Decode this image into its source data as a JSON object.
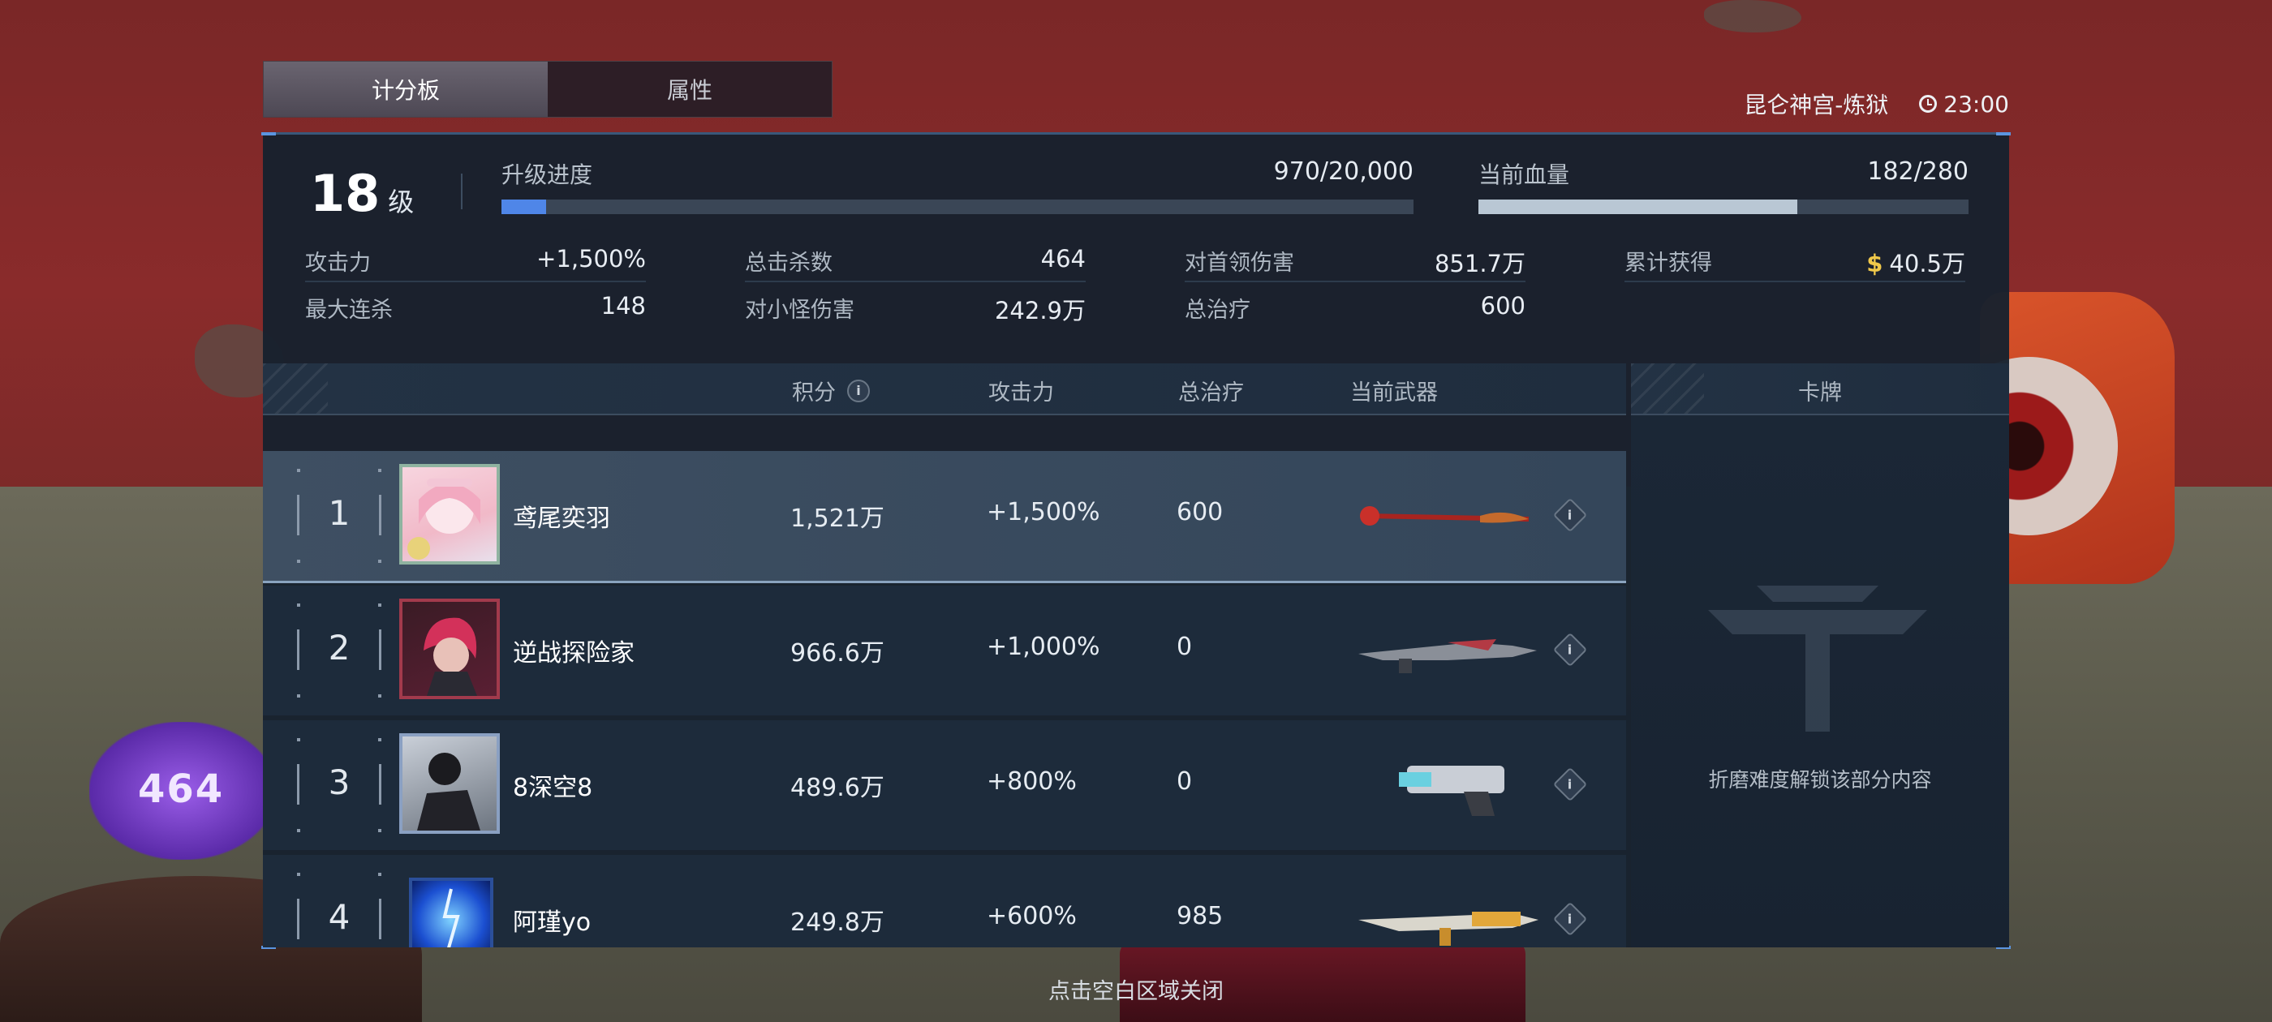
{
  "tabs": [
    {
      "label": "计分板",
      "active": true
    },
    {
      "label": "属性",
      "active": false
    }
  ],
  "map_name": "昆仑神宫-炼狱",
  "timer": "23:00",
  "level": {
    "value": "18",
    "unit": "级"
  },
  "upgrade_progress": {
    "label": "升级进度",
    "value": "970/20,000",
    "fraction": 0.0485,
    "color": "#4f86e8"
  },
  "hp": {
    "label": "当前血量",
    "value": "182/280",
    "fraction": 0.65,
    "color": "#b9c7d4"
  },
  "stats": {
    "attack": {
      "label": "攻击力",
      "value": "+1,500%"
    },
    "max_combo": {
      "label": "最大连杀",
      "value": "148"
    },
    "total_kills": {
      "label": "总击杀数",
      "value": "464"
    },
    "minion_damage": {
      "label": "对小怪伤害",
      "value": "242.9万"
    },
    "boss_damage": {
      "label": "对首领伤害",
      "value": "851.7万"
    },
    "total_heal": {
      "label": "总治疗",
      "value": "600"
    },
    "earned": {
      "label": "累计获得",
      "value": "40.5万",
      "currency_icon": "$"
    }
  },
  "table": {
    "headers": {
      "score": "积分",
      "attack": "攻击力",
      "heal": "总治疗",
      "weapon": "当前武器"
    },
    "info_icon": "i",
    "rows": [
      {
        "rank": "1",
        "name": "鸢尾奕羽",
        "score": "1,521万",
        "attack": "+1,500%",
        "heal": "600",
        "weapon_icon": "crimson-staff-icon"
      },
      {
        "rank": "2",
        "name": "逆战探险家",
        "score": "966.6万",
        "attack": "+1,000%",
        "heal": "0",
        "weapon_icon": "blade-rifle-icon"
      },
      {
        "rank": "3",
        "name": "8深空8",
        "score": "489.6万",
        "attack": "+800%",
        "heal": "0",
        "weapon_icon": "heavy-pistol-icon"
      },
      {
        "rank": "4",
        "name": "阿瑾yo",
        "score": "249.8万",
        "attack": "+600%",
        "heal": "985",
        "weapon_icon": "golden-rifle-icon"
      }
    ]
  },
  "cards": {
    "header": "卡牌",
    "locked_text": "折磨难度解锁该部分内容"
  },
  "close_hint": "点击空白区域关闭",
  "background": {
    "damage_number": "464"
  }
}
